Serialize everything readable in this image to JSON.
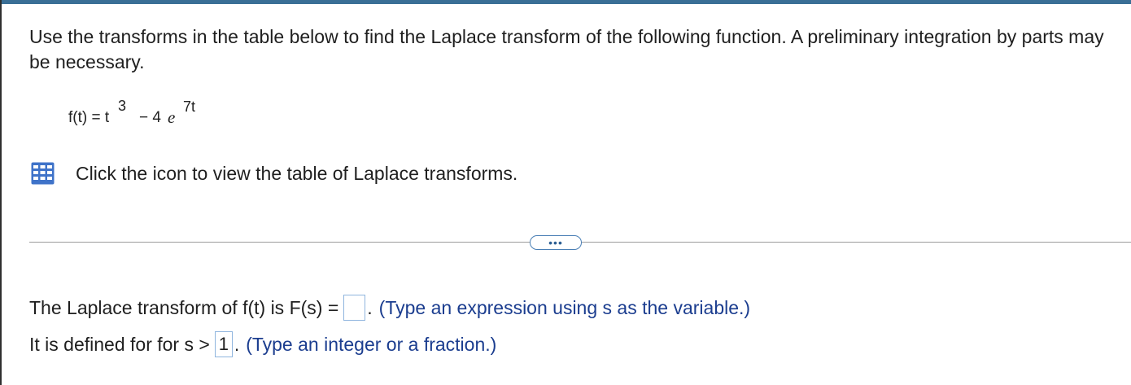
{
  "question": {
    "text": "Use the transforms in the table below to find the Laplace transform of the following function. A preliminary integration by parts may be necessary."
  },
  "formula": {
    "lhs": "f(t) = t",
    "exponent_t": "3",
    "minus_term": "− 4",
    "e_symbol": "e",
    "exponent_e": "7t"
  },
  "table_link": {
    "icon": "table-grid-icon",
    "text": "Click the icon to view the table of Laplace transforms."
  },
  "more_button": {
    "label": "•••"
  },
  "answer1": {
    "prefix": "The Laplace transform of f(t) is F(s) =",
    "value": "",
    "dot": ".",
    "hint": "(Type an expression using s as the variable.)"
  },
  "answer2": {
    "prefix": "It is defined for for s >",
    "value": "1",
    "dot": ".",
    "hint": "(Type an integer or a fraction.)"
  },
  "colors": {
    "accent": "#3a6f96",
    "hint": "#1b3d8f",
    "box_border": "#8fb5de",
    "icon": "#3f73c9"
  }
}
